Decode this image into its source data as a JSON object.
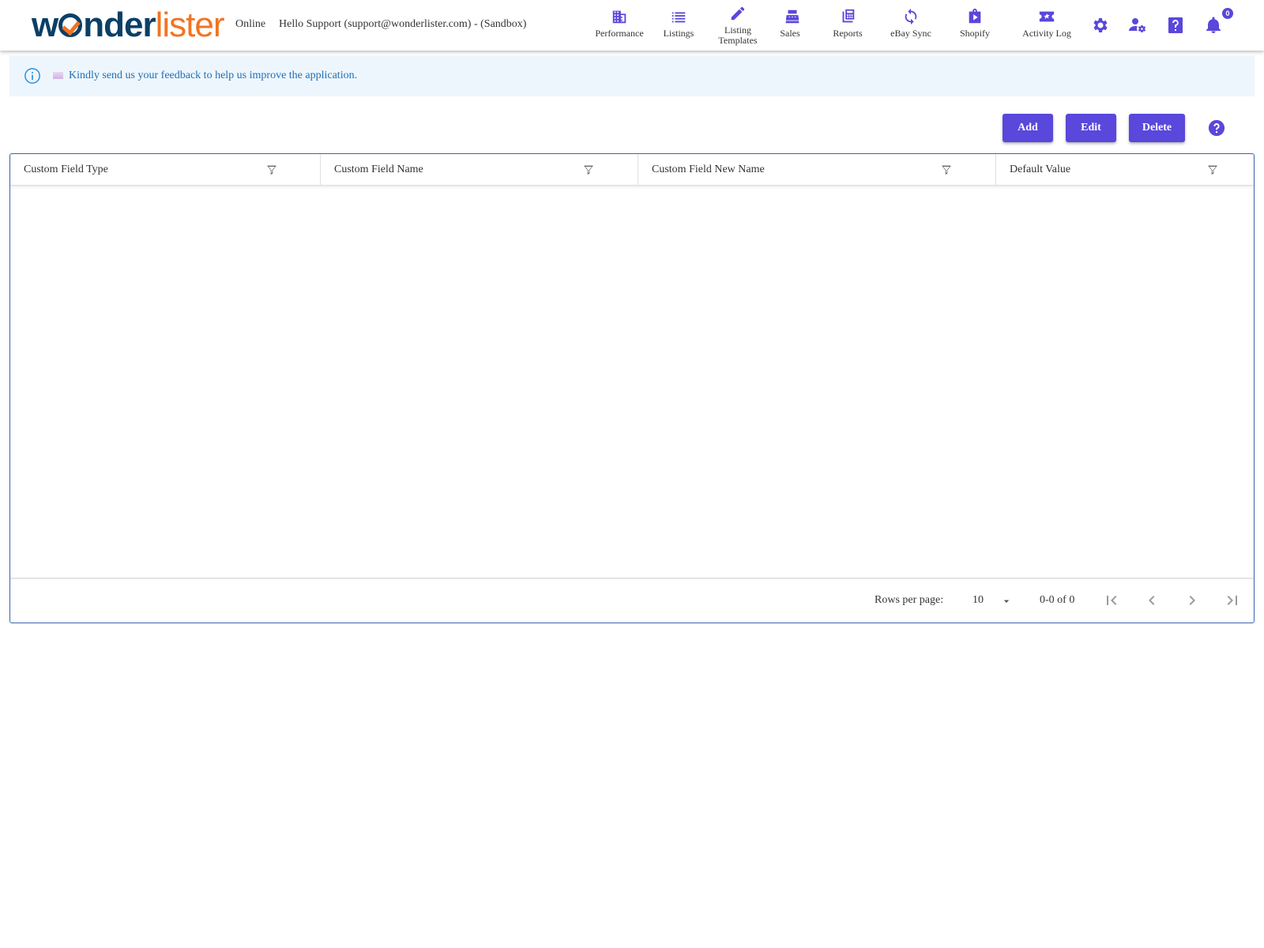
{
  "header": {
    "logo": {
      "part1": "w",
      "part2": "nder",
      "part3": "lister"
    },
    "status": "Online",
    "greeting": "Hello Support (support@wonderlister.com) - (Sandbox)",
    "nav": [
      {
        "label": "Performance",
        "icon": "building-icon"
      },
      {
        "label": "Listings",
        "icon": "list-icon"
      },
      {
        "label_line1": "Listing",
        "label_line2": "Templates",
        "icon": "pencil-icon"
      },
      {
        "label": "Sales",
        "icon": "cash-register-icon"
      },
      {
        "label": "Reports",
        "icon": "calculator-icon"
      },
      {
        "label": "eBay Sync",
        "icon": "sync-icon"
      },
      {
        "label": "Shopify",
        "icon": "shopify-bag-icon"
      },
      {
        "label": "Activity Log",
        "icon": "ticket-star-icon"
      }
    ],
    "notification_count": "0"
  },
  "banner": {
    "message": "Kindly send us your feedback to help us improve the application."
  },
  "toolbar": {
    "add_label": "Add",
    "edit_label": "Edit",
    "delete_label": "Delete"
  },
  "table": {
    "columns": [
      "Custom Field Type",
      "Custom Field Name",
      "Custom Field New Name",
      "Default Value"
    ],
    "rows": []
  },
  "pagination": {
    "rows_per_page_label": "Rows per page:",
    "rows_per_page": "10",
    "range": "0-0 of 0"
  },
  "colors": {
    "accent": "#5a47db",
    "banner_bg": "#eef6fd",
    "banner_text": "#1e6fb5",
    "logo_navy": "#0b3f66",
    "logo_orange": "#f37321"
  }
}
